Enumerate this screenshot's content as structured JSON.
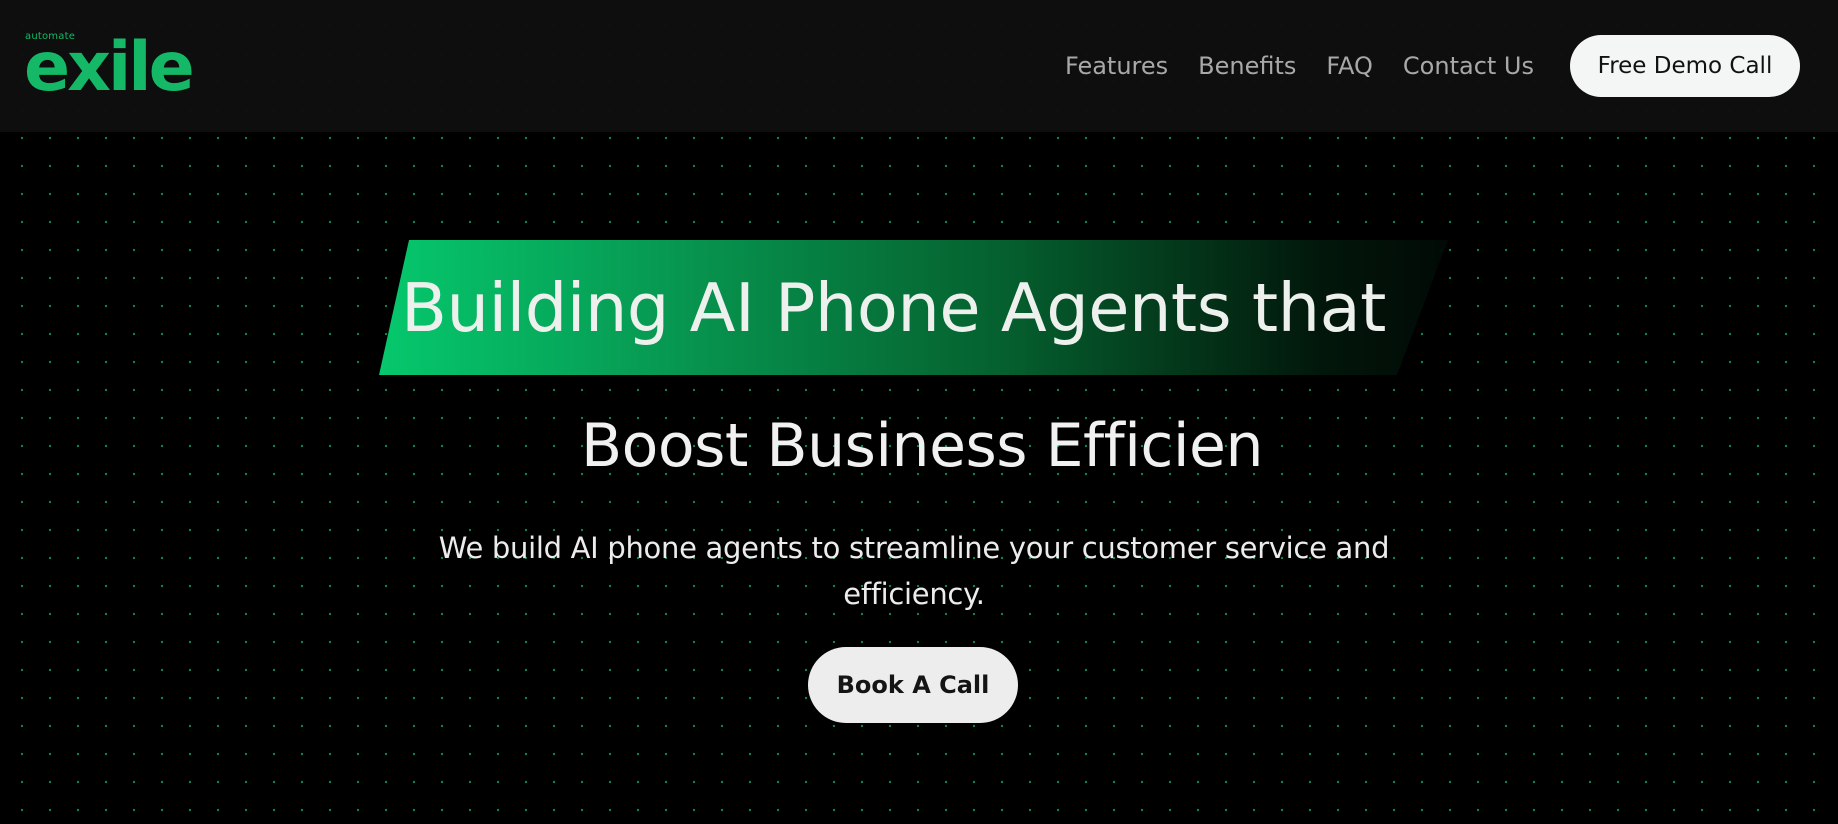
{
  "header": {
    "logo": {
      "small_text": "automate",
      "main_text": "exile"
    },
    "nav": [
      {
        "label": "Features"
      },
      {
        "label": "Benefits"
      },
      {
        "label": "FAQ"
      },
      {
        "label": "Contact Us"
      }
    ],
    "cta_label": "Free Demo Call"
  },
  "hero": {
    "headline_line1": "Building AI Phone Agents that",
    "headline_line2": "Boost Business Efficien",
    "subtext": "We build AI phone agents to streamline your customer service and efficiency.",
    "button_label": "Book A Call"
  },
  "colors": {
    "brand_green": "#14b866",
    "background": "#000000",
    "header_background": "#0e0e0e",
    "nav_text": "#a8a8a8",
    "button_background": "#eeeded"
  }
}
